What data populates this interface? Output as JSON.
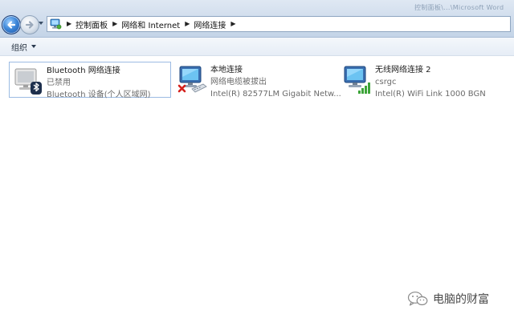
{
  "window": {
    "title": "控制面板\\...\\Microsoft Word"
  },
  "breadcrumb": {
    "items": [
      "控制面板",
      "网络和 Internet",
      "网络连接"
    ]
  },
  "toolbar": {
    "organize_label": "组织"
  },
  "connections": [
    {
      "name": "Bluetooth 网络连接",
      "status": "已禁用",
      "device": "Bluetooth 设备(个人区域网)",
      "icon": "bluetooth-network-icon",
      "selected": true
    },
    {
      "name": "本地连接",
      "status": "网络电缆被拔出",
      "device": "Intel(R) 82577LM Gigabit Netw...",
      "icon": "wired-network-disconnected-icon",
      "selected": false
    },
    {
      "name": "无线网络连接 2",
      "status": "csrgc",
      "device": "Intel(R) WiFi Link 1000 BGN",
      "icon": "wireless-network-icon",
      "selected": false
    }
  ],
  "watermark": {
    "text": "电脑的财富",
    "icon": "wechat-logo-icon"
  }
}
